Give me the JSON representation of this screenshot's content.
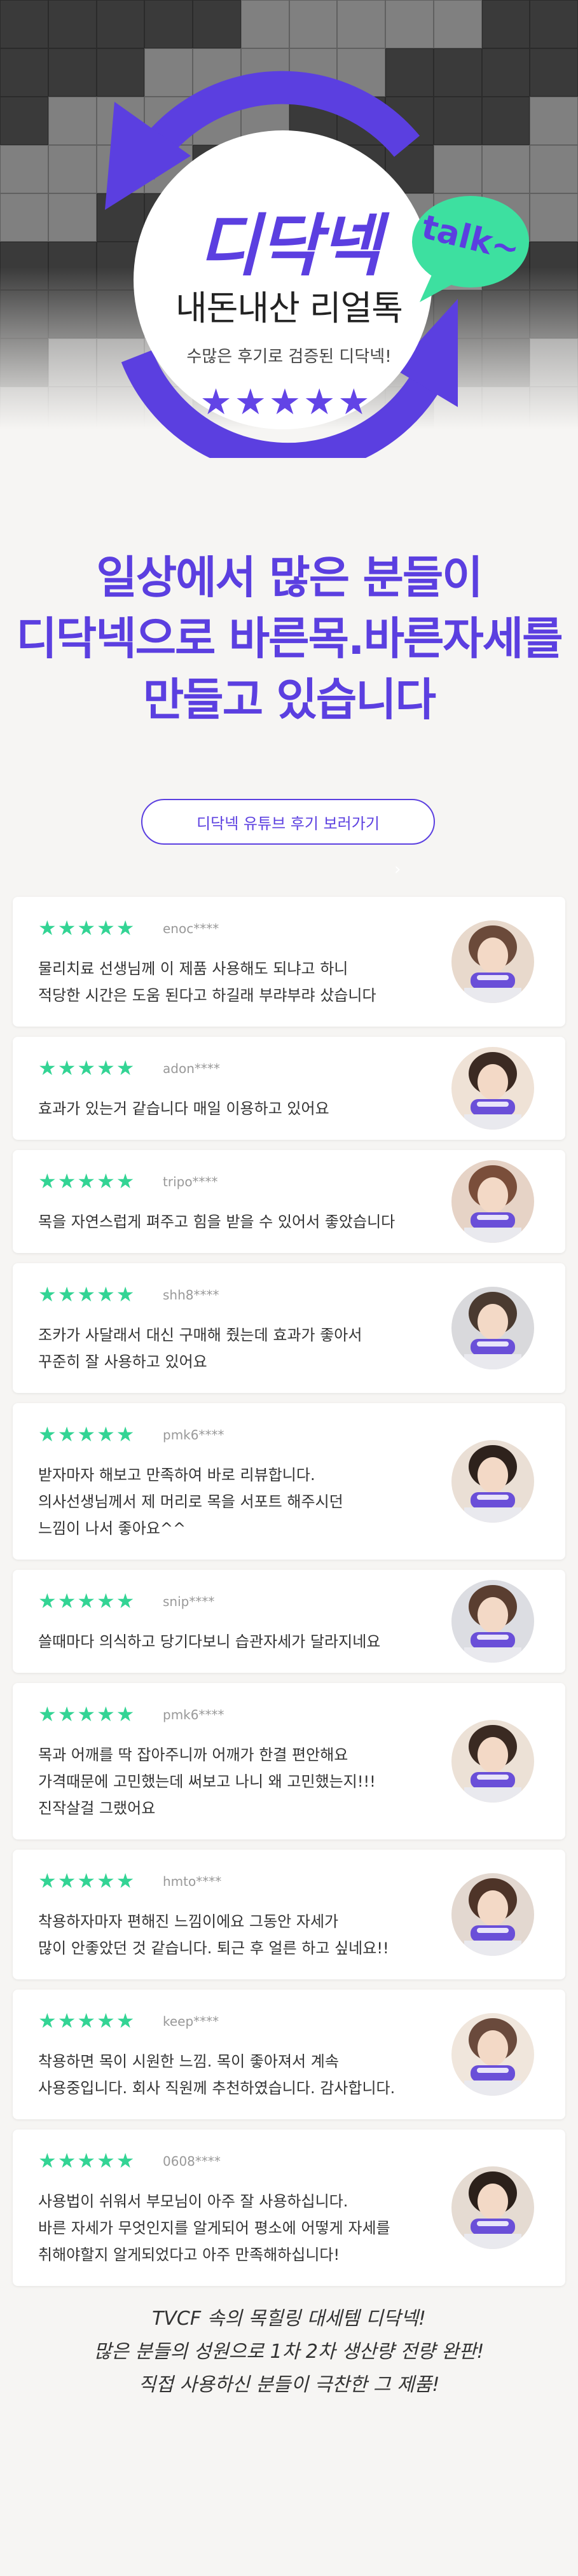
{
  "hero": {
    "brand": "디닥넥",
    "subtitle": "내돈내산 리얼톡",
    "tagline": "수많은 후기로 검증된 디닥넥!",
    "stars": "★★★★★",
    "badge": "talk~",
    "accent_color": "#5b3fe0",
    "badge_color": "#3de0a0"
  },
  "headline": {
    "line1": "일상에서 많은 분들이",
    "line2": "디닥넥으로 바른목.바른자세를",
    "line3": "만들고 있습니다"
  },
  "youtube_button": {
    "label": "디닥넥 유튜브 후기 보러가기"
  },
  "review_star_color": "#33d494",
  "reviews": [
    {
      "stars": "★★★★★",
      "user": "enoc****",
      "lines": [
        "물리치료 선생님께 이 제품 사용해도 되냐고 하니",
        "적당한 시간은 도움 된다고 하길래 부랴부랴 샀습니다"
      ]
    },
    {
      "stars": "★★★★★",
      "user": "adon****",
      "lines": [
        "효과가 있는거 같습니다 매일 이용하고 있어요"
      ]
    },
    {
      "stars": "★★★★★",
      "user": "tripo****",
      "lines": [
        "목을 자연스럽게 펴주고 힘을 받을 수 있어서 좋았습니다"
      ]
    },
    {
      "stars": "★★★★★",
      "user": "shh8****",
      "lines": [
        "조카가 사달래서 대신 구매해 줬는데 효과가 좋아서",
        "꾸준히 잘 사용하고 있어요"
      ]
    },
    {
      "stars": "★★★★★",
      "user": "pmk6****",
      "lines": [
        "받자마자 해보고 만족하여 바로 리뷰합니다.",
        "의사선생님께서 제 머리로 목을 서포트 해주시던",
        "느낌이 나서 좋아요^^"
      ]
    },
    {
      "stars": "★★★★★",
      "user": "snip****",
      "lines": [
        "쓸때마다 의식하고 당기다보니 습관자세가 달라지네요"
      ]
    },
    {
      "stars": "★★★★★",
      "user": "pmk6****",
      "lines": [
        "목과 어깨를 딱 잡아주니까 어깨가 한결 편안해요",
        "가격때문에 고민했는데 써보고 나니 왜 고민했는지!!!",
        "진작살걸 그랬어요"
      ]
    },
    {
      "stars": "★★★★★",
      "user": "hmto****",
      "lines": [
        "착용하자마자 편해진 느낌이에요 그동안 자세가",
        "많이 안좋았던 것 같습니다. 퇴근 후 얼른 하고 싶네요!!"
      ]
    },
    {
      "stars": "★★★★★",
      "user": "keep****",
      "lines": [
        "착용하면 목이 시원한 느낌. 목이 좋아져서 계속",
        "사용중입니다. 회사 직원께 추천하였습니다. 감사합니다."
      ]
    },
    {
      "stars": "★★★★★",
      "user": "0608****",
      "lines": [
        "사용법이 쉬워서 부모님이 아주 잘 사용하십니다.",
        "바른 자세가 무엇인지를 알게되어 평소에 어떻게 자세를",
        "취해야할지 알게되었다고 아주 만족해하십니다!"
      ]
    }
  ],
  "footer": {
    "line1": "TVCF 속의 목힐링 대세템 디닥넥!",
    "line2": "많은 분들의 성원으로 1차 2차 생산량 전량 완판!",
    "line3": "직접 사용하신 분들이 극찬한 그 제품!"
  }
}
